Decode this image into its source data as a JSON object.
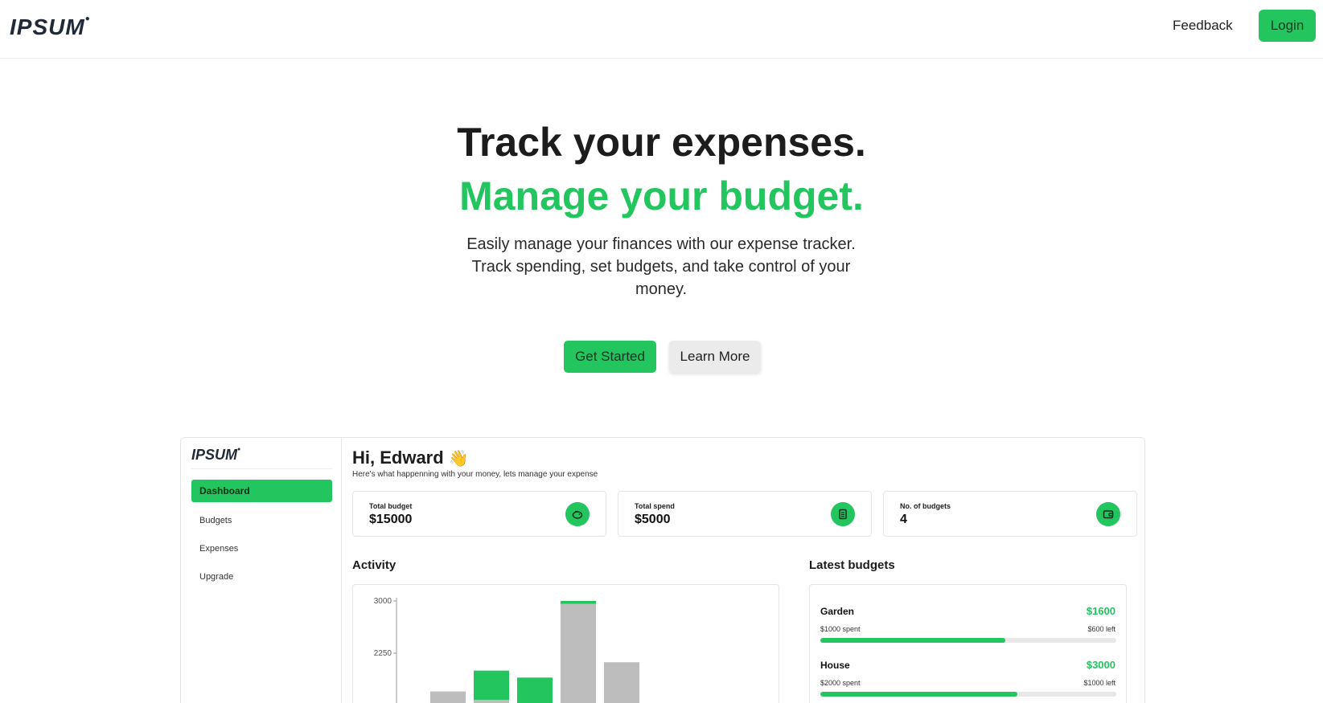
{
  "header": {
    "logo": "IPSUM",
    "feedback_label": "Feedback",
    "login_label": "Login"
  },
  "hero": {
    "title": "Track your expenses.",
    "subtitle": "Manage your budget.",
    "description": "Easily manage your finances with our expense tracker. Track spending, set budgets, and take control of your money.",
    "get_started_label": "Get Started",
    "learn_more_label": "Learn More"
  },
  "colors": {
    "accent": "#22c55e",
    "text": "#1c1c1c"
  },
  "preview": {
    "logo": "IPSUM",
    "sidebar": {
      "items": [
        {
          "label": "Dashboard",
          "active": true
        },
        {
          "label": "Budgets",
          "active": false
        },
        {
          "label": "Expenses",
          "active": false
        },
        {
          "label": "Upgrade",
          "active": false
        }
      ]
    },
    "greeting": "Hi, Edward",
    "greeting_emoji": "👋",
    "subtitle": "Here's what happenning with your money, lets manage your expense",
    "stats": [
      {
        "label": "Total budget",
        "value": "$15000",
        "icon": "piggy-bank-icon"
      },
      {
        "label": "Total spend",
        "value": "$5000",
        "icon": "receipt-icon"
      },
      {
        "label": "No. of budgets",
        "value": "4",
        "icon": "wallet-icon"
      }
    ],
    "activity_title": "Activity",
    "latest_title": "Latest budgets",
    "budgets": [
      {
        "name": "Garden",
        "amount": "$1600",
        "spent": "$1000 spent",
        "left": "$600 left",
        "progress": 0.625
      },
      {
        "name": "House",
        "amount": "$3000",
        "spent": "$2000 spent",
        "left": "$1000 left",
        "progress": 0.667
      }
    ]
  },
  "chart_data": {
    "type": "bar",
    "title": "",
    "xlabel": "",
    "ylabel": "",
    "ylim": [
      0,
      3000
    ],
    "y_ticks": [
      "3000",
      "2250"
    ],
    "series": [
      {
        "values": [
          1500,
          2000,
          1900,
          3000,
          2100
        ],
        "color": "#22c55e"
      },
      {
        "values": [
          1700,
          1580,
          1500,
          2960,
          2120
        ],
        "color": "#bdbdbd"
      }
    ]
  }
}
